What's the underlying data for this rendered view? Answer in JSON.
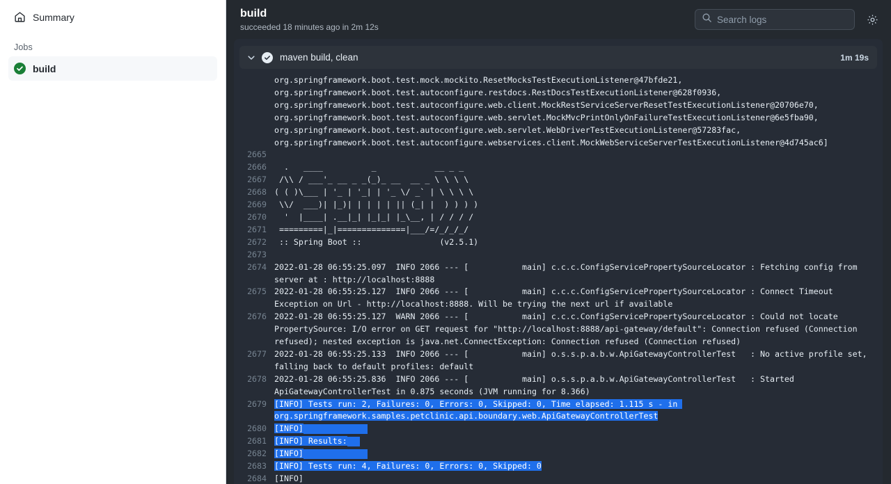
{
  "sidebar": {
    "summary_label": "Summary",
    "summary_icon": "home-icon",
    "jobs_heading": "Jobs",
    "jobs": [
      {
        "name": "build",
        "status": "success",
        "status_icon": "check-circle-icon"
      }
    ]
  },
  "header": {
    "title": "build",
    "subtitle": "succeeded 18 minutes ago in 2m 12s",
    "search_placeholder": "Search logs",
    "search_value": "",
    "search_icon": "search-icon",
    "settings_icon": "gear-icon"
  },
  "step": {
    "name": "maven build, clean",
    "duration": "1m 19s",
    "status_icon": "check-circle-icon",
    "expanded": true,
    "toggle_icon": "chevron-down-icon"
  },
  "colors": {
    "page_bg": "#24292f",
    "log_panel_bg": "#262c36",
    "step_header_bg": "#2d333b",
    "selection_blue": "#1f6feb",
    "success_green": "#1a7f37",
    "line_number": "#768390",
    "log_text": "#e6edf3",
    "sidebar_bg": "#ffffff",
    "sidebar_row_bg": "#f6f8fa"
  },
  "log": {
    "lines": [
      {
        "num": "",
        "text": "org.springframework.boot.test.mock.mockito.ResetMocksTestExecutionListener@47bfde21,"
      },
      {
        "num": "",
        "text": "org.springframework.boot.test.autoconfigure.restdocs.RestDocsTestExecutionListener@628f0936,"
      },
      {
        "num": "",
        "text": "org.springframework.boot.test.autoconfigure.web.client.MockRestServiceServerResetTestExecutionListener@20706e70,"
      },
      {
        "num": "",
        "text": "org.springframework.boot.test.autoconfigure.web.servlet.MockMvcPrintOnlyOnFailureTestExecutionListener@6e5fba90,"
      },
      {
        "num": "",
        "text": "org.springframework.boot.test.autoconfigure.web.servlet.WebDriverTestExecutionListener@57283fac,"
      },
      {
        "num": "",
        "text": "org.springframework.boot.test.autoconfigure.webservices.client.MockWebServiceServerTestExecutionListener@4d745ac6]"
      },
      {
        "num": "2665",
        "text": ""
      },
      {
        "num": "2666",
        "text": "  .   ____          _            __ _ _"
      },
      {
        "num": "2667",
        "text": " /\\\\ / ___'_ __ _ _(_)_ __  __ _ \\ \\ \\ \\"
      },
      {
        "num": "2668",
        "text": "( ( )\\___ | '_ | '_| | '_ \\/ _` | \\ \\ \\ \\"
      },
      {
        "num": "2669",
        "text": " \\\\/  ___)| |_)| | | | | || (_| |  ) ) ) )"
      },
      {
        "num": "2670",
        "text": "  '  |____| .__|_| |_|_| |_\\__, | / / / /"
      },
      {
        "num": "2671",
        "text": " =========|_|==============|___/=/_/_/_/"
      },
      {
        "num": "2672",
        "text": " :: Spring Boot ::                (v2.5.1)"
      },
      {
        "num": "2673",
        "text": ""
      },
      {
        "num": "2674",
        "text": "2022-01-28 06:55:25.097  INFO 2066 --- [           main] c.c.c.ConfigServicePropertySourceLocator : Fetching config from server at : http://localhost:8888"
      },
      {
        "num": "2675",
        "text": "2022-01-28 06:55:25.127  INFO 2066 --- [           main] c.c.c.ConfigServicePropertySourceLocator : Connect Timeout Exception on Url - http://localhost:8888. Will be trying the next url if available"
      },
      {
        "num": "2676",
        "text": "2022-01-28 06:55:25.127  WARN 2066 --- [           main] c.c.c.ConfigServicePropertySourceLocator : Could not locate PropertySource: I/O error on GET request for \"http://localhost:8888/api-gateway/default\": Connection refused (Connection refused); nested exception is java.net.ConnectException: Connection refused (Connection refused)"
      },
      {
        "num": "2677",
        "text": "2022-01-28 06:55:25.133  INFO 2066 --- [           main] o.s.s.p.a.b.w.ApiGatewayControllerTest   : No active profile set, falling back to default profiles: default"
      },
      {
        "num": "2678",
        "text": "2022-01-28 06:55:25.836  INFO 2066 --- [           main] o.s.s.p.a.b.w.ApiGatewayControllerTest   : Started ApiGatewayControllerTest in 0.875 seconds (JVM running for 8.366)"
      },
      {
        "num": "2679",
        "text": "[INFO] Tests run: 2, Failures: 0, Errors: 0, Skipped: 0, Time elapsed: 1.115 s - in org.springframework.samples.petclinic.api.boundary.web.ApiGatewayControllerTest",
        "selected": true
      },
      {
        "num": "2680",
        "text": "[INFO]",
        "selected": true,
        "sel_pad": 92
      },
      {
        "num": "2681",
        "text": "[INFO] Results:",
        "selected": true,
        "sel_pad": 18
      },
      {
        "num": "2682",
        "text": "[INFO]",
        "selected": true,
        "sel_pad": 92
      },
      {
        "num": "2683",
        "text": "[INFO] Tests run: 4, Failures: 0, Errors: 0, Skipped: 0",
        "selected": true
      },
      {
        "num": "2684",
        "text": "[INFO]"
      }
    ]
  }
}
